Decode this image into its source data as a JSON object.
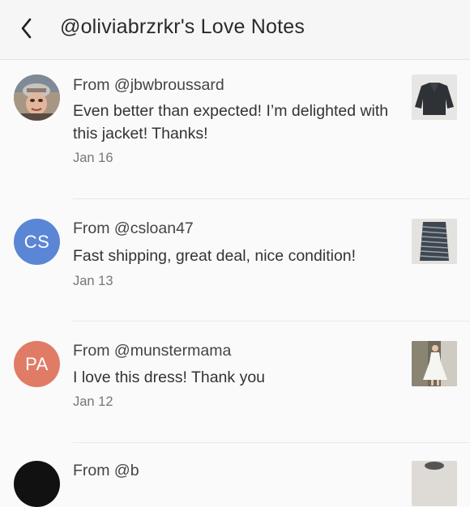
{
  "header": {
    "title": "@oliviabrzrkr's Love Notes",
    "back_icon": "chevron-left-icon"
  },
  "notes": [
    {
      "from": "From @jbwbroussard",
      "message": "Even better than expected! I’m delighted with this jacket! Thanks!",
      "date": "Jan 16",
      "avatar_initials": "",
      "avatar_kind": "photo",
      "item": "jacket"
    },
    {
      "from": "From @csloan47",
      "message": "Fast shipping, great deal, nice condition!",
      "date": "Jan 13",
      "avatar_initials": "CS",
      "avatar_color": "#5b86d6",
      "item": "striped skirt"
    },
    {
      "from": "From @munstermama",
      "message": "I love this dress! Thank you",
      "date": "Jan 12",
      "avatar_initials": "PA",
      "avatar_color": "#e07c66",
      "item": "white dress"
    },
    {
      "from": "From @b",
      "avatar_kind": "photo",
      "item": "partial"
    }
  ]
}
